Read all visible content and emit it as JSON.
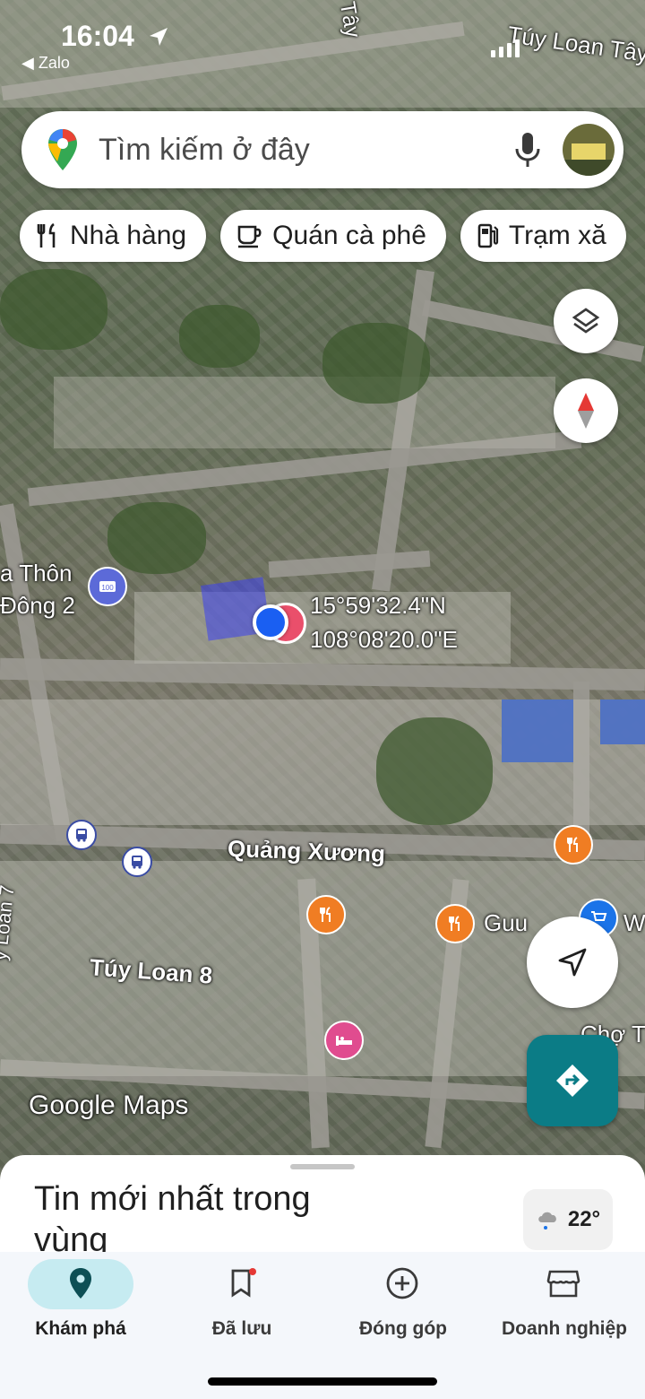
{
  "status_bar": {
    "time": "16:04",
    "back_app": "◀ Zalo"
  },
  "search": {
    "placeholder": "Tìm kiếm ở đây"
  },
  "chips": [
    {
      "label": "Nhà hàng",
      "icon": "fork-knife-icon"
    },
    {
      "label": "Quán cà phê",
      "icon": "coffee-cup-icon"
    },
    {
      "label": "Trạm xă",
      "icon": "gas-station-icon"
    }
  ],
  "map": {
    "coordinates": {
      "lat": "15°59'32.4\"N",
      "lng": "108°08'20.0\"E"
    },
    "labels": {
      "top_right_street": "Túy Loan Tây",
      "top_street": "Tây",
      "village": "a Thôn",
      "village_2": "Đông 2",
      "street_1": "Quảng Xương",
      "street_2": "Túy Loan 8",
      "place_guu": "Guu",
      "place_w": "W",
      "place_cho": "Chợ T",
      "left_vertical": "y Loan 7",
      "watermark": "Google Maps"
    },
    "colors": {
      "direction_button": "#0b7c86",
      "poi_food": "#f07d23",
      "poi_hotel": "#e04c8f",
      "poi_shop": "#1a73e8",
      "my_location": "#1a5ff2"
    }
  },
  "sheet": {
    "title": "Tin mới nhất trong vùng",
    "temperature": "22°"
  },
  "nav": [
    {
      "label": "Khám phá",
      "icon": "location-pin-icon",
      "active": true
    },
    {
      "label": "Đã lưu",
      "icon": "bookmark-icon",
      "active": false
    },
    {
      "label": "Đóng góp",
      "icon": "plus-circle-icon",
      "active": false
    },
    {
      "label": "Doanh nghiệp",
      "icon": "storefront-icon",
      "active": false
    }
  ]
}
